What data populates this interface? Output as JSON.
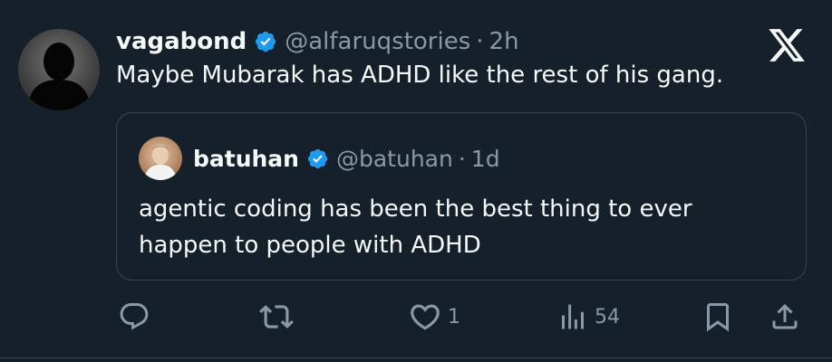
{
  "tweet": {
    "author_name": "vagabond",
    "author_handle": "@alfaruqstories",
    "separator": "·",
    "time": "2h",
    "text": "Maybe Mubarak has ADHD like the rest of his gang.",
    "verified_badge": "verified-icon",
    "avatar_icon": "user-avatar"
  },
  "quoted_tweet": {
    "author_name": "batuhan",
    "author_handle": "@batuhan",
    "separator": "·",
    "time": "1d",
    "text_line1": "agentic coding has been the best thing to ever",
    "text_line2": "happen to people with ADHD",
    "verified_badge": "verified-icon"
  },
  "actions": {
    "reply": {
      "icon": "reply-icon",
      "count": ""
    },
    "retweet": {
      "icon": "retweet-icon",
      "count": ""
    },
    "like": {
      "icon": "heart-icon",
      "count": "1"
    },
    "views": {
      "icon": "views-icon",
      "count": "54"
    },
    "bookmark": {
      "icon": "bookmark-icon"
    },
    "share": {
      "icon": "share-icon"
    }
  },
  "brand": {
    "logo": "x-logo-icon"
  },
  "colors": {
    "background": "#15202b",
    "text": "#f7f9f9",
    "muted": "#8b98a5",
    "verified": "#1d9bf0",
    "border": "#38444d"
  }
}
